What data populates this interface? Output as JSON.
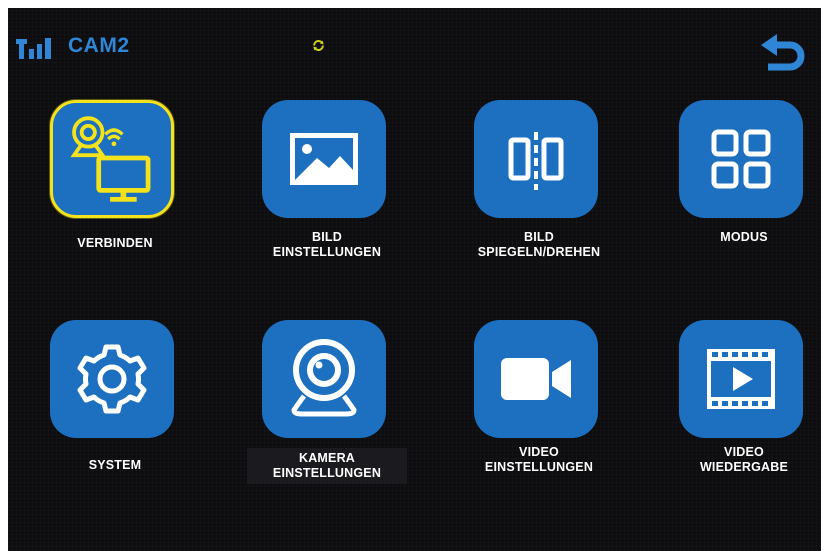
{
  "status_bar": {
    "signal_icon": "signal-strength-icon",
    "camera_name": "CAM2",
    "loading_icon": "sync-icon",
    "back_icon": "back-arrow-icon"
  },
  "colors": {
    "tile_blue": "#1d6fbf",
    "selected_border": "#f4e21c",
    "camera_name": "#2f86d6",
    "background": "#0d0d0f"
  },
  "menu": {
    "items": [
      {
        "id": "verbinden",
        "icon": "camera-connect-icon",
        "lines": [
          "VERBINDEN"
        ],
        "selected": true
      },
      {
        "id": "bild-einstellungen",
        "icon": "image-icon",
        "lines": [
          "BILD",
          "EINSTELLUNGEN"
        ],
        "selected": false
      },
      {
        "id": "bild-spiegeln-drehen",
        "icon": "mirror-icon",
        "lines": [
          "BILD",
          "SPIEGELN/DREHEN"
        ],
        "selected": false
      },
      {
        "id": "modus",
        "icon": "grid-icon",
        "lines": [
          "MODUS"
        ],
        "selected": false
      },
      {
        "id": "system",
        "icon": "gear-icon",
        "lines": [
          "SYSTEM"
        ],
        "selected": false
      },
      {
        "id": "kamera-einstellungen",
        "icon": "webcam-icon",
        "lines": [
          "KAMERA",
          "EINSTELLUNGEN"
        ],
        "selected": false
      },
      {
        "id": "video-einstellungen",
        "icon": "video-camera-icon",
        "lines": [
          "VIDEO",
          "EINSTELLUNGEN"
        ],
        "selected": false
      },
      {
        "id": "video-wiedergabe",
        "icon": "film-play-icon",
        "lines": [
          "VIDEO",
          "WIEDERGABE"
        ],
        "selected": false
      }
    ]
  }
}
